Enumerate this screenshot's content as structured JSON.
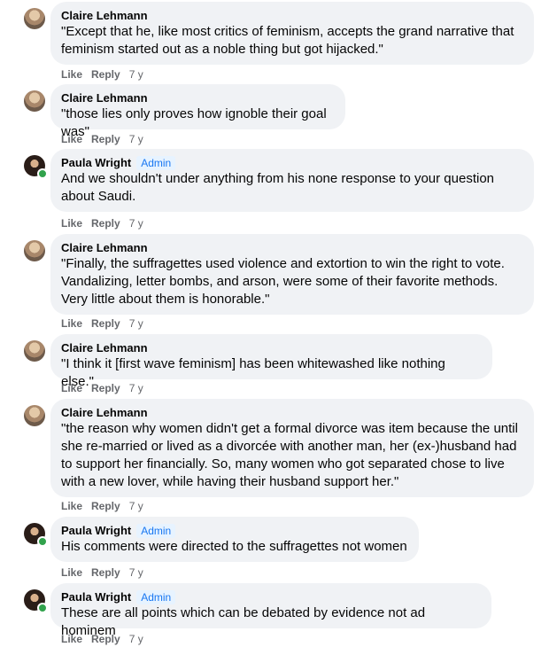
{
  "comments": [
    {
      "author": "Claire Lehmann",
      "avatar_icon": "profile-photo-claire",
      "badge": "",
      "text": "\"Except that he, like most critics of feminism, accepts the grand narrative that feminism started out as a noble thing but got hijacked.\"",
      "like": "Like",
      "reply": "Reply",
      "time": "7 y"
    },
    {
      "author": "Claire Lehmann",
      "avatar_icon": "profile-photo-claire",
      "badge": "",
      "text": "\"those lies only proves how ignoble their goal was\"",
      "like": "Like",
      "reply": "Reply",
      "time": "7 y"
    },
    {
      "author": "Paula Wright",
      "avatar_icon": "profile-photo-paula",
      "badge": "Admin",
      "text": "And we shouldn't under anything from his none response to your question about Saudi.",
      "like": "Like",
      "reply": "Reply",
      "time": "7 y"
    },
    {
      "author": "Claire Lehmann",
      "avatar_icon": "profile-photo-claire",
      "badge": "",
      "text": "\"Finally, the suffragettes used violence and extortion to win the right to vote. Vandalizing, letter bombs, and arson, were some of their favorite methods. Very little about them is honorable.\"",
      "like": "Like",
      "reply": "Reply",
      "time": "7 y"
    },
    {
      "author": "Claire Lehmann",
      "avatar_icon": "profile-photo-claire",
      "badge": "",
      "text": "\"I think it [first wave feminism] has been whitewashed like nothing else.\"",
      "like": "Like",
      "reply": "Reply",
      "time": "7 y"
    },
    {
      "author": "Claire Lehmann",
      "avatar_icon": "profile-photo-claire",
      "badge": "",
      "text": "\"the reason why women didn't get a formal divorce was item because the until she re-married or lived as a divorcée with another man, her (ex-)husband had to support her financially. So, many women who got separated chose to live with a new lover, while having their husband support her.\"",
      "like": "Like",
      "reply": "Reply",
      "time": "7 y"
    },
    {
      "author": "Paula Wright",
      "avatar_icon": "profile-photo-paula",
      "badge": "Admin",
      "text": "His comments were directed to the suffragettes not women",
      "like": "Like",
      "reply": "Reply",
      "time": "7 y"
    },
    {
      "author": "Paula Wright",
      "avatar_icon": "profile-photo-paula",
      "badge": "Admin",
      "text": "These are all points which can be debated by evidence not ad hominem",
      "like": "Like",
      "reply": "Reply",
      "time": "7 y"
    }
  ]
}
